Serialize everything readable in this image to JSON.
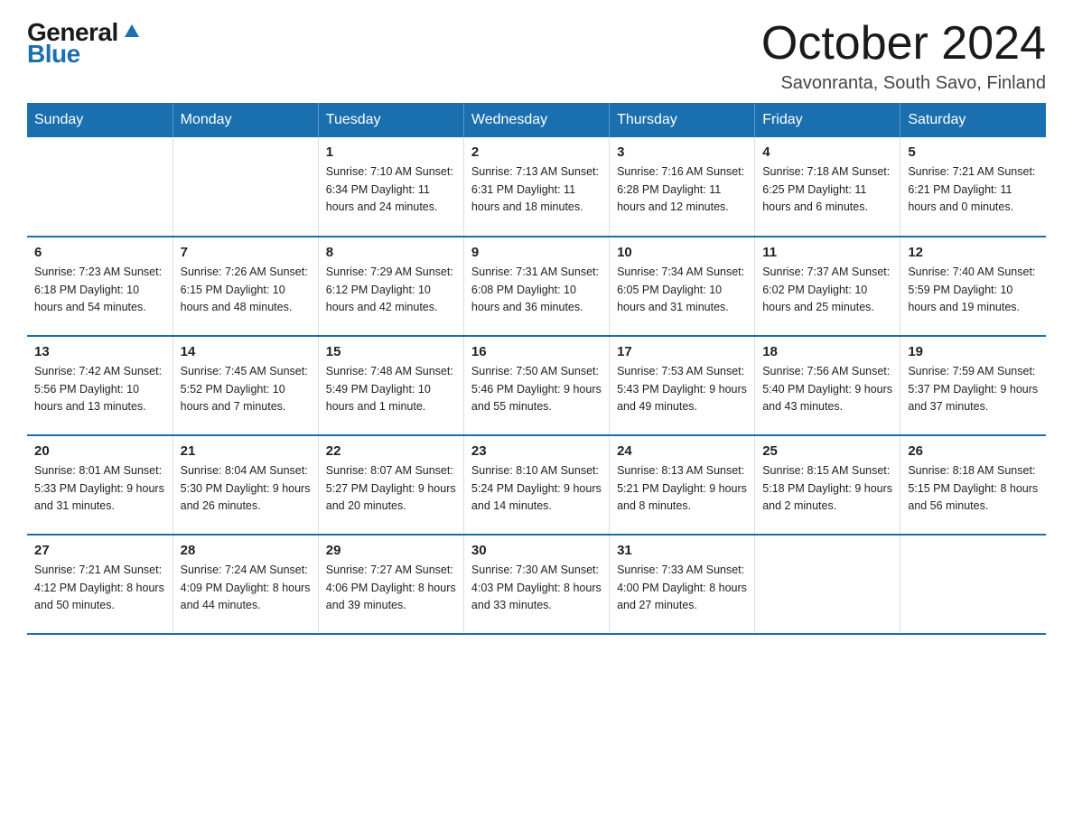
{
  "logo": {
    "general": "General",
    "blue": "Blue"
  },
  "title": "October 2024",
  "location": "Savonranta, South Savo, Finland",
  "headers": [
    "Sunday",
    "Monday",
    "Tuesday",
    "Wednesday",
    "Thursday",
    "Friday",
    "Saturday"
  ],
  "weeks": [
    [
      {
        "day": "",
        "info": ""
      },
      {
        "day": "",
        "info": ""
      },
      {
        "day": "1",
        "info": "Sunrise: 7:10 AM\nSunset: 6:34 PM\nDaylight: 11 hours\nand 24 minutes."
      },
      {
        "day": "2",
        "info": "Sunrise: 7:13 AM\nSunset: 6:31 PM\nDaylight: 11 hours\nand 18 minutes."
      },
      {
        "day": "3",
        "info": "Sunrise: 7:16 AM\nSunset: 6:28 PM\nDaylight: 11 hours\nand 12 minutes."
      },
      {
        "day": "4",
        "info": "Sunrise: 7:18 AM\nSunset: 6:25 PM\nDaylight: 11 hours\nand 6 minutes."
      },
      {
        "day": "5",
        "info": "Sunrise: 7:21 AM\nSunset: 6:21 PM\nDaylight: 11 hours\nand 0 minutes."
      }
    ],
    [
      {
        "day": "6",
        "info": "Sunrise: 7:23 AM\nSunset: 6:18 PM\nDaylight: 10 hours\nand 54 minutes."
      },
      {
        "day": "7",
        "info": "Sunrise: 7:26 AM\nSunset: 6:15 PM\nDaylight: 10 hours\nand 48 minutes."
      },
      {
        "day": "8",
        "info": "Sunrise: 7:29 AM\nSunset: 6:12 PM\nDaylight: 10 hours\nand 42 minutes."
      },
      {
        "day": "9",
        "info": "Sunrise: 7:31 AM\nSunset: 6:08 PM\nDaylight: 10 hours\nand 36 minutes."
      },
      {
        "day": "10",
        "info": "Sunrise: 7:34 AM\nSunset: 6:05 PM\nDaylight: 10 hours\nand 31 minutes."
      },
      {
        "day": "11",
        "info": "Sunrise: 7:37 AM\nSunset: 6:02 PM\nDaylight: 10 hours\nand 25 minutes."
      },
      {
        "day": "12",
        "info": "Sunrise: 7:40 AM\nSunset: 5:59 PM\nDaylight: 10 hours\nand 19 minutes."
      }
    ],
    [
      {
        "day": "13",
        "info": "Sunrise: 7:42 AM\nSunset: 5:56 PM\nDaylight: 10 hours\nand 13 minutes."
      },
      {
        "day": "14",
        "info": "Sunrise: 7:45 AM\nSunset: 5:52 PM\nDaylight: 10 hours\nand 7 minutes."
      },
      {
        "day": "15",
        "info": "Sunrise: 7:48 AM\nSunset: 5:49 PM\nDaylight: 10 hours\nand 1 minute."
      },
      {
        "day": "16",
        "info": "Sunrise: 7:50 AM\nSunset: 5:46 PM\nDaylight: 9 hours\nand 55 minutes."
      },
      {
        "day": "17",
        "info": "Sunrise: 7:53 AM\nSunset: 5:43 PM\nDaylight: 9 hours\nand 49 minutes."
      },
      {
        "day": "18",
        "info": "Sunrise: 7:56 AM\nSunset: 5:40 PM\nDaylight: 9 hours\nand 43 minutes."
      },
      {
        "day": "19",
        "info": "Sunrise: 7:59 AM\nSunset: 5:37 PM\nDaylight: 9 hours\nand 37 minutes."
      }
    ],
    [
      {
        "day": "20",
        "info": "Sunrise: 8:01 AM\nSunset: 5:33 PM\nDaylight: 9 hours\nand 31 minutes."
      },
      {
        "day": "21",
        "info": "Sunrise: 8:04 AM\nSunset: 5:30 PM\nDaylight: 9 hours\nand 26 minutes."
      },
      {
        "day": "22",
        "info": "Sunrise: 8:07 AM\nSunset: 5:27 PM\nDaylight: 9 hours\nand 20 minutes."
      },
      {
        "day": "23",
        "info": "Sunrise: 8:10 AM\nSunset: 5:24 PM\nDaylight: 9 hours\nand 14 minutes."
      },
      {
        "day": "24",
        "info": "Sunrise: 8:13 AM\nSunset: 5:21 PM\nDaylight: 9 hours\nand 8 minutes."
      },
      {
        "day": "25",
        "info": "Sunrise: 8:15 AM\nSunset: 5:18 PM\nDaylight: 9 hours\nand 2 minutes."
      },
      {
        "day": "26",
        "info": "Sunrise: 8:18 AM\nSunset: 5:15 PM\nDaylight: 8 hours\nand 56 minutes."
      }
    ],
    [
      {
        "day": "27",
        "info": "Sunrise: 7:21 AM\nSunset: 4:12 PM\nDaylight: 8 hours\nand 50 minutes."
      },
      {
        "day": "28",
        "info": "Sunrise: 7:24 AM\nSunset: 4:09 PM\nDaylight: 8 hours\nand 44 minutes."
      },
      {
        "day": "29",
        "info": "Sunrise: 7:27 AM\nSunset: 4:06 PM\nDaylight: 8 hours\nand 39 minutes."
      },
      {
        "day": "30",
        "info": "Sunrise: 7:30 AM\nSunset: 4:03 PM\nDaylight: 8 hours\nand 33 minutes."
      },
      {
        "day": "31",
        "info": "Sunrise: 7:33 AM\nSunset: 4:00 PM\nDaylight: 8 hours\nand 27 minutes."
      },
      {
        "day": "",
        "info": ""
      },
      {
        "day": "",
        "info": ""
      }
    ]
  ]
}
